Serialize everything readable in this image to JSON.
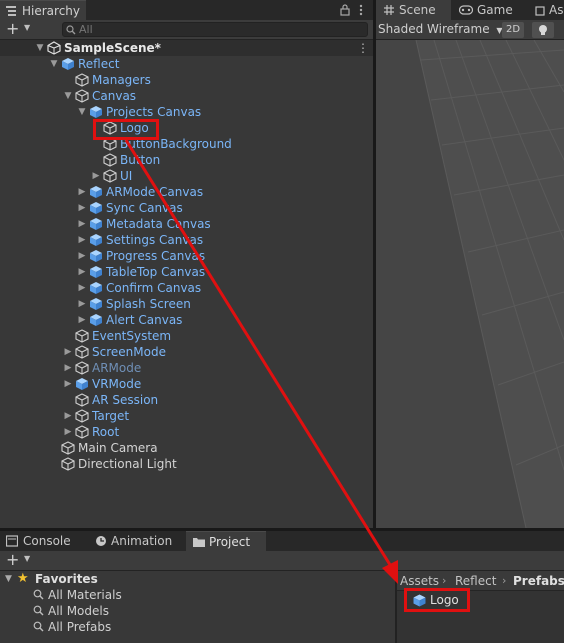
{
  "hierarchy": {
    "tab_label": "Hierarchy",
    "add_label": "+",
    "search_placeholder": "All",
    "rows": [
      {
        "label": "SampleScene*",
        "depth": 0,
        "arrow": "down",
        "icon": "unity-scene-icon",
        "color": "scene"
      },
      {
        "label": "Reflect",
        "depth": 1,
        "arrow": "down",
        "icon": "prefab-cube-icon",
        "color": "blue"
      },
      {
        "label": "Managers",
        "depth": 2,
        "arrow": "none",
        "icon": "gameobject-outline-icon",
        "color": "blue"
      },
      {
        "label": "Canvas",
        "depth": 2,
        "arrow": "down",
        "icon": "gameobject-outline-icon",
        "color": "blue"
      },
      {
        "label": "Projects Canvas",
        "depth": 3,
        "arrow": "down",
        "icon": "prefab-cube-icon",
        "color": "blue"
      },
      {
        "label": "Logo",
        "depth": 4,
        "arrow": "none",
        "icon": "gameobject-outline-icon",
        "color": "blue"
      },
      {
        "label": "ButtonBackground",
        "depth": 4,
        "arrow": "none",
        "icon": "gameobject-outline-icon",
        "color": "blue"
      },
      {
        "label": "Button",
        "depth": 4,
        "arrow": "none",
        "icon": "gameobject-outline-icon",
        "color": "blue"
      },
      {
        "label": "UI",
        "depth": 4,
        "arrow": "right",
        "icon": "gameobject-outline-icon",
        "color": "blue"
      },
      {
        "label": "ARMode Canvas",
        "depth": 3,
        "arrow": "right",
        "icon": "prefab-cube-icon",
        "color": "blue"
      },
      {
        "label": "Sync Canvas",
        "depth": 3,
        "arrow": "right",
        "icon": "prefab-cube-icon",
        "color": "blue"
      },
      {
        "label": "Metadata Canvas",
        "depth": 3,
        "arrow": "right",
        "icon": "prefab-cube-icon",
        "color": "blue"
      },
      {
        "label": "Settings Canvas",
        "depth": 3,
        "arrow": "right",
        "icon": "prefab-cube-icon",
        "color": "blue"
      },
      {
        "label": "Progress Canvas",
        "depth": 3,
        "arrow": "right",
        "icon": "prefab-cube-icon",
        "color": "blue"
      },
      {
        "label": "TableTop Canvas",
        "depth": 3,
        "arrow": "right",
        "icon": "prefab-cube-icon",
        "color": "blue"
      },
      {
        "label": "Confirm Canvas",
        "depth": 3,
        "arrow": "right",
        "icon": "prefab-cube-icon",
        "color": "blue"
      },
      {
        "label": "Splash Screen",
        "depth": 3,
        "arrow": "right",
        "icon": "prefab-cube-icon",
        "color": "blue"
      },
      {
        "label": "Alert Canvas",
        "depth": 3,
        "arrow": "right",
        "icon": "prefab-cube-icon",
        "color": "blue"
      },
      {
        "label": "EventSystem",
        "depth": 2,
        "arrow": "none",
        "icon": "gameobject-outline-icon",
        "color": "blue"
      },
      {
        "label": "ScreenMode",
        "depth": 2,
        "arrow": "right",
        "icon": "gameobject-outline-icon",
        "color": "blue"
      },
      {
        "label": "ARMode",
        "depth": 2,
        "arrow": "right",
        "icon": "gameobject-outline-icon",
        "color": "dim"
      },
      {
        "label": "VRMode",
        "depth": 2,
        "arrow": "right",
        "icon": "prefab-cube-icon",
        "color": "blue"
      },
      {
        "label": "AR Session",
        "depth": 2,
        "arrow": "none",
        "icon": "gameobject-outline-icon",
        "color": "blue"
      },
      {
        "label": "Target",
        "depth": 2,
        "arrow": "right",
        "icon": "gameobject-outline-icon",
        "color": "blue"
      },
      {
        "label": "Root",
        "depth": 2,
        "arrow": "right",
        "icon": "gameobject-outline-icon",
        "color": "blue"
      },
      {
        "label": "Main Camera",
        "depth": 1,
        "arrow": "none",
        "icon": "gameobject-outline-icon",
        "color": "white"
      },
      {
        "label": "Directional Light",
        "depth": 1,
        "arrow": "none",
        "icon": "gameobject-outline-icon",
        "color": "white"
      }
    ]
  },
  "scene_view": {
    "tabs": [
      "Scene",
      "Game",
      "Ass"
    ],
    "shading_mode": "Shaded Wireframe",
    "mode_2d_label": "2D"
  },
  "bottom": {
    "tabs": [
      "Console",
      "Animation",
      "Project"
    ],
    "add_label": "+",
    "favorites": {
      "title": "Favorites",
      "items": [
        "All Materials",
        "All Models",
        "All Prefabs"
      ]
    },
    "breadcrumb": [
      "Assets",
      "Reflect",
      "Prefabs"
    ],
    "asset": "Logo"
  },
  "colors": {
    "highlight": "#e01010",
    "prefab_blue": "#7bb6f8",
    "background": "#383838"
  }
}
